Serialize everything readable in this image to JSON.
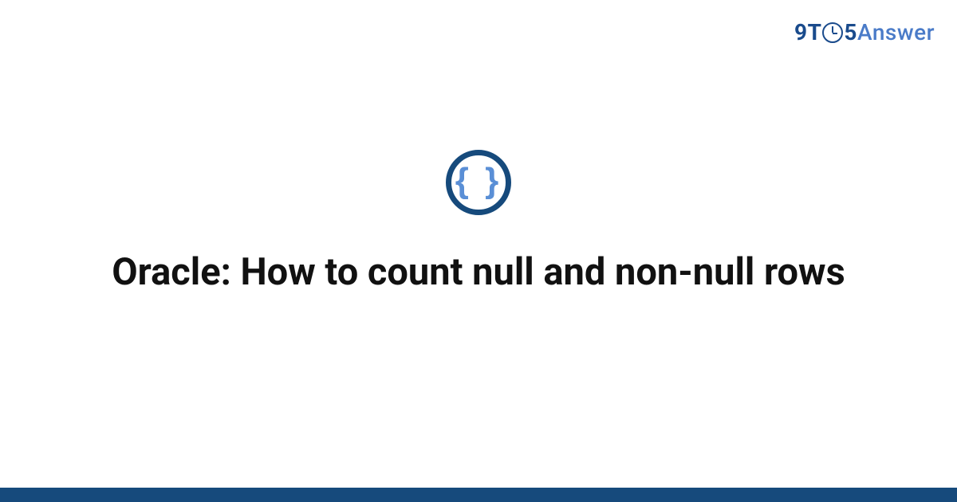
{
  "brand": {
    "part1": "9T",
    "part2": "5",
    "part3": "Answer"
  },
  "category_icon": {
    "name": "code-braces-icon",
    "glyph": "{ }"
  },
  "title": "Oracle: How to count null and non-null rows",
  "colors": {
    "brand_dark": "#164a7c",
    "brand_light": "#4a7bc8",
    "text": "#111111"
  }
}
